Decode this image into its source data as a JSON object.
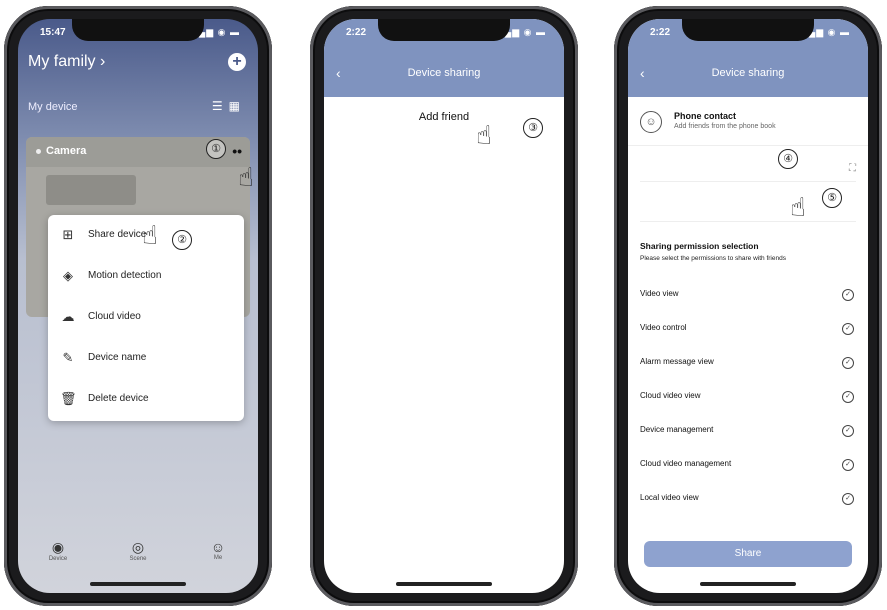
{
  "phone1": {
    "time": "15:47",
    "family_title": "My family",
    "my_device": "My device",
    "camera_name": "Camera",
    "more_glyph": "••",
    "menu": [
      "Share device",
      "Motion detection",
      "Cloud video",
      "Device name",
      "Delete device"
    ],
    "nav": [
      "Device",
      "Scene",
      "Me"
    ]
  },
  "phone2": {
    "time": "2:22",
    "title": "Device sharing",
    "add_friend": "Add friend"
  },
  "phone3": {
    "time": "2:22",
    "title": "Device sharing",
    "phone_contact": "Phone contact",
    "phone_contact_sub": "Add friends from the phone book",
    "field1_placeholder": "",
    "field2_placeholder": "",
    "perm_title": "Sharing permission selection",
    "perm_sub": "Please select the permissions to share with friends",
    "permissions": [
      "Video view",
      "Video control",
      "Alarm message view",
      "Cloud video view",
      "Device management",
      "Cloud video management",
      "Local video view"
    ],
    "share_label": "Share"
  },
  "annotations": [
    "①",
    "②",
    "③",
    "④",
    "⑤"
  ],
  "colors": {
    "header": "#7f93bf",
    "family_bg": "#4a5a8a",
    "share_button": "#8ea2cf"
  }
}
